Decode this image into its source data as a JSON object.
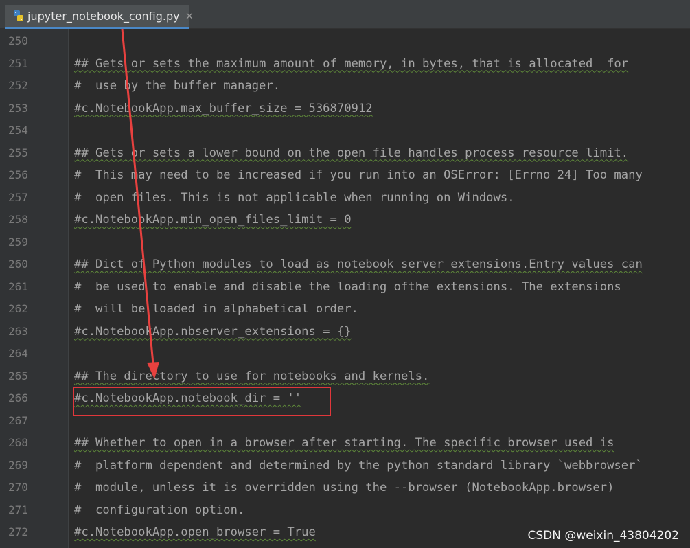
{
  "tab": {
    "label": "jupyter_notebook_config.py",
    "close": "×"
  },
  "lines": [
    {
      "num": "250",
      "text": ""
    },
    {
      "num": "251",
      "text": "## Gets or sets the maximum amount of memory, in bytes, that is allocated  for"
    },
    {
      "num": "252",
      "text": "#  use by the buffer manager."
    },
    {
      "num": "253",
      "text": "#c.NotebookApp.max_buffer_size = 536870912"
    },
    {
      "num": "254",
      "text": ""
    },
    {
      "num": "255",
      "text": "## Gets or sets a lower bound on the open file handles process resource limit."
    },
    {
      "num": "256",
      "text": "#  This may need to be increased if you run into an OSError: [Errno 24] Too many"
    },
    {
      "num": "257",
      "text": "#  open files. This is not applicable when running on Windows."
    },
    {
      "num": "258",
      "text": "#c.NotebookApp.min_open_files_limit = 0"
    },
    {
      "num": "259",
      "text": ""
    },
    {
      "num": "260",
      "text": "## Dict of Python modules to load as notebook server extensions.Entry values can"
    },
    {
      "num": "261",
      "text": "#  be used to enable and disable the loading ofthe extensions. The extensions"
    },
    {
      "num": "262",
      "text": "#  will be loaded in alphabetical order."
    },
    {
      "num": "263",
      "text": "#c.NotebookApp.nbserver_extensions = {}"
    },
    {
      "num": "264",
      "text": ""
    },
    {
      "num": "265",
      "text": "## The directory to use for notebooks and kernels."
    },
    {
      "num": "266",
      "text": "#c.NotebookApp.notebook_dir = ''"
    },
    {
      "num": "267",
      "text": ""
    },
    {
      "num": "268",
      "text": "## Whether to open in a browser after starting. The specific browser used is"
    },
    {
      "num": "269",
      "text": "#  platform dependent and determined by the python standard library `webbrowser`"
    },
    {
      "num": "270",
      "text": "#  module, unless it is overridden using the --browser (NotebookApp.browser)"
    },
    {
      "num": "271",
      "text": "#  configuration option."
    },
    {
      "num": "272",
      "text": "#c.NotebookApp.open_browser = True"
    }
  ],
  "annotation": {
    "arrow_color": "#e8413f",
    "box_color": "#e0373b"
  },
  "watermark": "CSDN @weixin_43804202",
  "colors": {
    "editor_bg": "#2b2b2b",
    "gutter_bg": "#313335",
    "tab_accent": "#4a88c7"
  }
}
